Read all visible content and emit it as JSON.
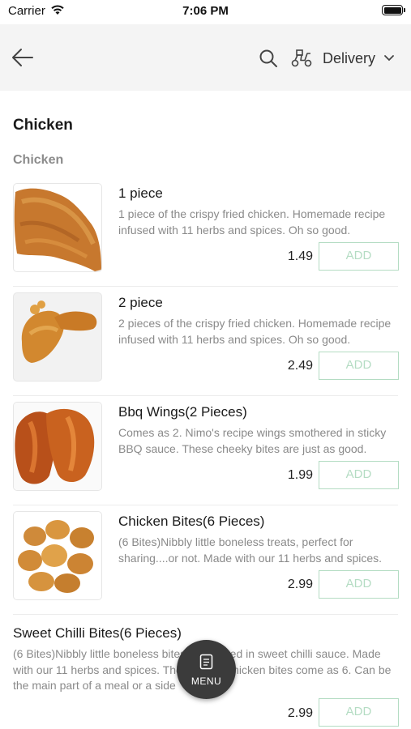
{
  "status_bar": {
    "carrier": "Carrier",
    "time": "7:06 PM"
  },
  "header": {
    "back_icon": "arrow-left-icon",
    "search_icon": "search-icon",
    "delivery_icon": "scooter-icon",
    "delivery_label": "Delivery",
    "dropdown_icon": "chevron-down-icon"
  },
  "category": {
    "title": "Chicken",
    "subtitle": "Chicken"
  },
  "items": [
    {
      "name": "1 piece",
      "description": "1 piece of the crispy fried chicken. Homemade recipe infused with 11 herbs and spices. Oh so good.",
      "price": "1.49",
      "add_label": "ADD"
    },
    {
      "name": "2 piece",
      "description": "2 pieces of the crispy fried chicken. Homemade recipe infused with 11 herbs and spices. Oh so good.",
      "price": "2.49",
      "add_label": "ADD"
    },
    {
      "name": "Bbq Wings(2 Pieces)",
      "description": "Comes as 2. Nimo's recipe wings smothered in sticky BBQ sauce. These cheeky bites are just as good.",
      "price": "1.99",
      "add_label": "ADD"
    },
    {
      "name": "Chicken Bites(6 Pieces)",
      "description": "(6 Bites)Nibbly little boneless treats, perfect for sharing....or not. Made with our 11 herbs and spices.",
      "price": "2.99",
      "add_label": "ADD"
    },
    {
      "name": "Sweet Chilli Bites(6 Pieces)",
      "description": "(6 Bites)Nibbly little boneless bites smothered in sweet chilli sauce. Made with our 11 herbs and spices. The bitesize chicken bites come as 6. Can be the main part of a meal or a side",
      "price": "2.99",
      "add_label": "ADD"
    }
  ],
  "menu_button": {
    "label": "MENU",
    "icon": "menu-card-icon"
  },
  "colors": {
    "nav_bg": "#f4f4f4",
    "add_border": "#b4dcc3",
    "fab_bg": "#3b3b3b"
  }
}
